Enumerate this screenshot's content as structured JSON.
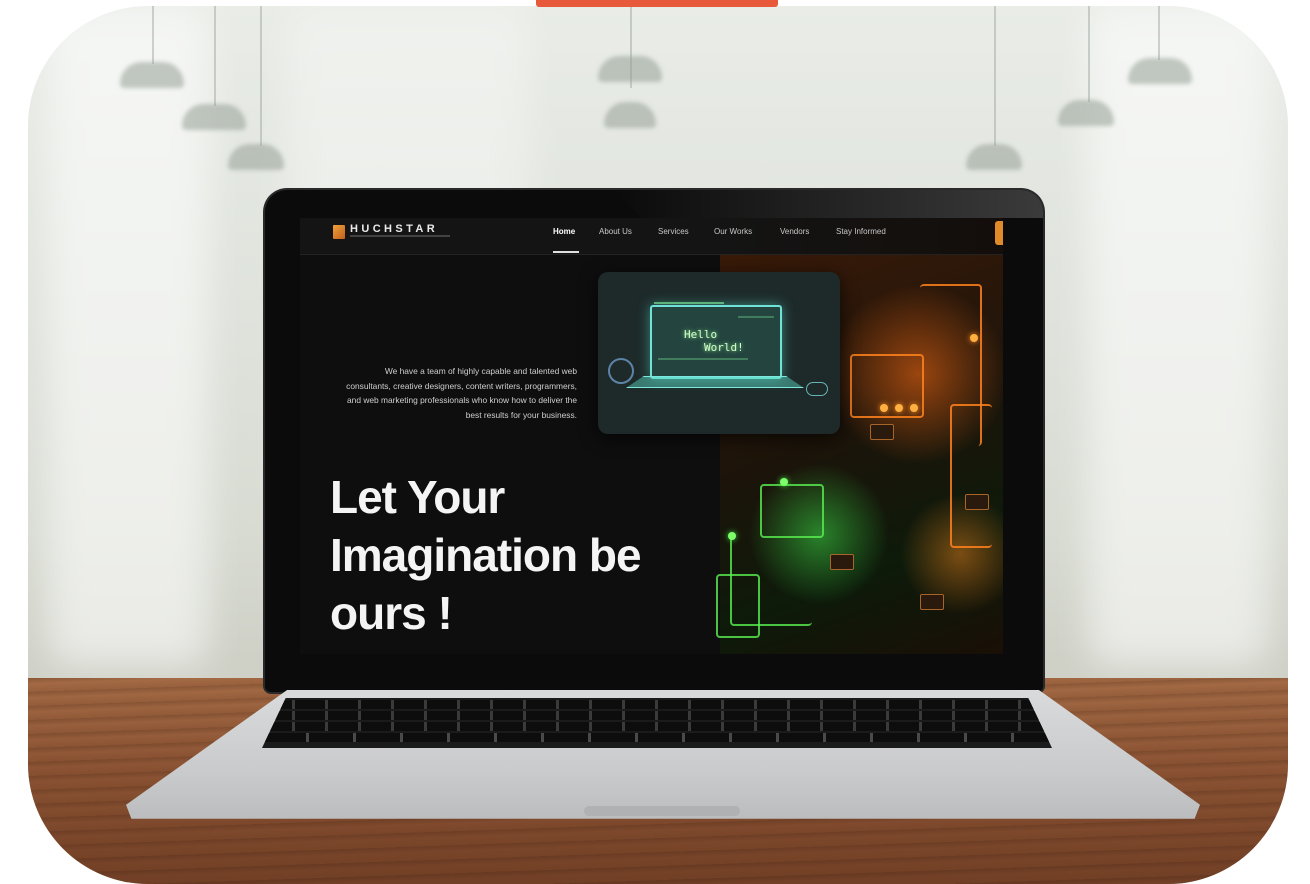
{
  "brand": {
    "name": "HUCHSTAR"
  },
  "nav": {
    "links": [
      "Home",
      "About Us",
      "Services",
      "Our Works",
      "Vendors",
      "Stay Informed"
    ],
    "active_index": 0
  },
  "hero": {
    "description": "We have a team of highly capable and talented web consultants, creative designers, content writers, programmers, and web marketing professionals who know how to deliver the best results for your business.",
    "title_line1": "Let Your",
    "title_line2": "Imagination be",
    "title_line3": "ours !",
    "card_code_line1": "Hello",
    "card_code_line2": "World!"
  },
  "colors": {
    "accent": "#e8583a",
    "brand_orange": "#e08a2a",
    "page_bg": "#0e0e0f"
  },
  "icons": {
    "logo": "huchstar-logo-icon"
  }
}
